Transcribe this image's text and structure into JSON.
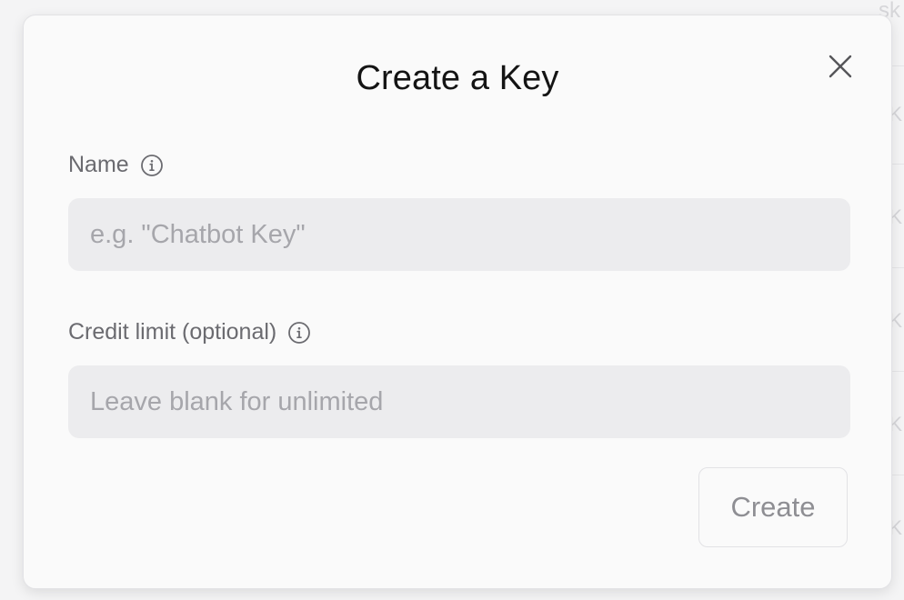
{
  "background": {
    "partial_text": "sk",
    "partial_glyph": "K"
  },
  "modal": {
    "title": "Create a Key",
    "close_icon": "close-icon",
    "fields": [
      {
        "label": "Name",
        "info_icon": "info-icon",
        "value": "",
        "placeholder": "e.g. \"Chatbot Key\""
      },
      {
        "label": "Credit limit (optional)",
        "info_icon": "info-icon",
        "value": "",
        "placeholder": "Leave blank for unlimited"
      }
    ],
    "submit_label": "Create"
  },
  "colors": {
    "modal_background": "#fafafa",
    "input_background": "#ececee",
    "title_text": "#141414",
    "label_text": "#6b6b70",
    "placeholder_text": "#a6a6ab",
    "button_text": "#8e8e93"
  }
}
